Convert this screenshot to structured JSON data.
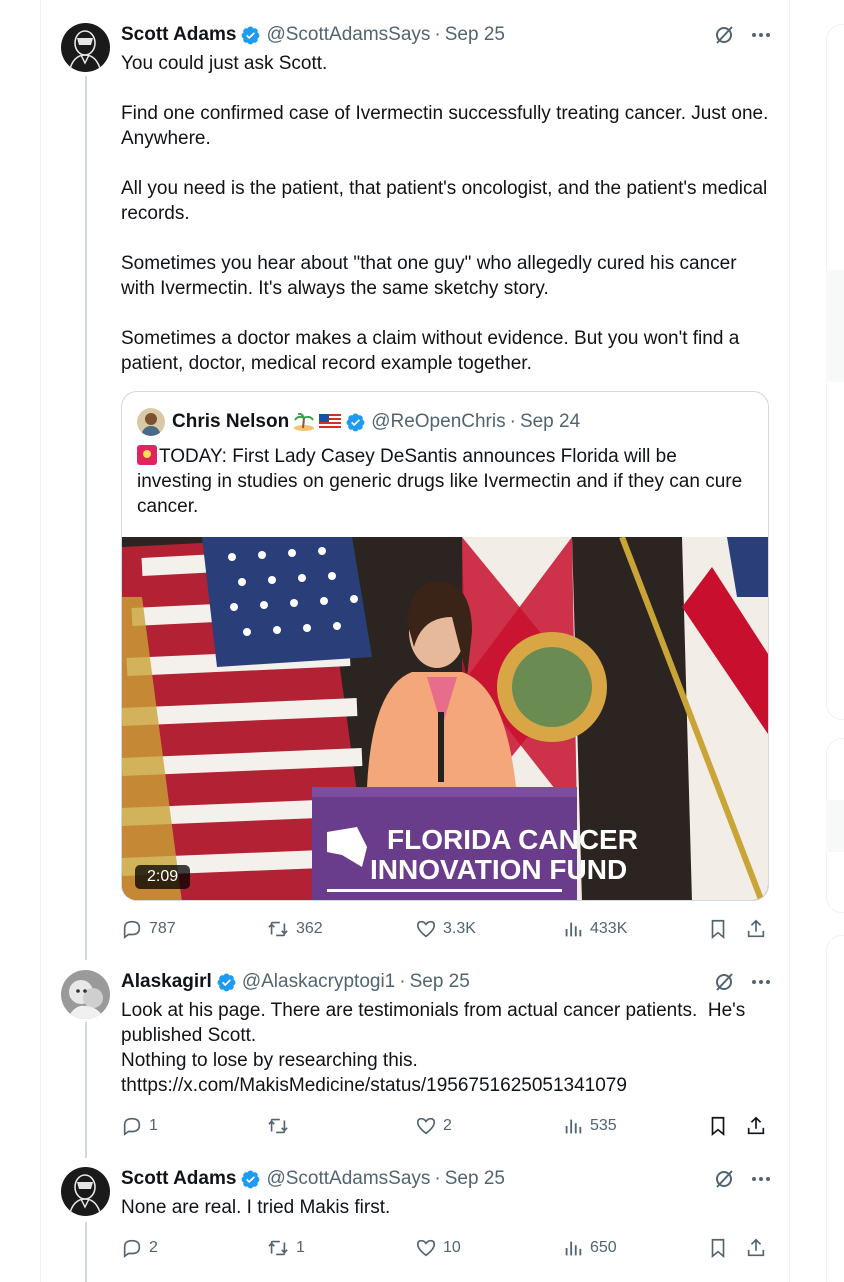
{
  "colors": {
    "text": "#0f1419",
    "secondary": "#536471",
    "verified": "#1d9bf0",
    "border": "#cfd9de"
  },
  "tweets": [
    {
      "name": "Scott Adams",
      "handle": "@ScottAdamsSays",
      "date": "Sep 25",
      "text": "You could just ask Scott.\n\nFind one confirmed case of Ivermectin successfully treating cancer. Just one. Anywhere.\n\nAll you need is the patient, that patient's oncologist, and the patient's medical records.\n\nSometimes you hear about \"that one guy\" who allegedly cured his cancer with Ivermectin. It's always the same sketchy story.\n\nSometimes a doctor makes a claim without evidence. But you won't find a patient, doctor, medical record example together.",
      "quote": {
        "name": "Chris Nelson",
        "emojis": [
          "island-emoji",
          "us-flag-emoji"
        ],
        "handle": "@ReOpenChris",
        "date": "Sep 24",
        "text": "TODAY: First Lady Casey DeSantis announces Florida will be investing in studies on generic drugs like Ivermectin and if they can cure cancer.",
        "video": {
          "duration": "2:09",
          "podium_line1": "FLORIDA CANCER",
          "podium_line2": "INNOVATION FUND"
        }
      },
      "stats": {
        "replies": "787",
        "retweets": "362",
        "likes": "3.3K",
        "views": "433K"
      }
    },
    {
      "name": "Alaskagirl",
      "handle": "@Alaskacryptogi1",
      "date": "Sep 25",
      "text": "Look at his page. There are testimonials from actual cancer patients.  He's published Scott.\nNothing to lose by researching this.\nthttps://x.com/MakisMedicine/status/1956751625051341079",
      "stats": {
        "replies": "1",
        "retweets": "",
        "likes": "2",
        "views": "535"
      }
    },
    {
      "name": "Scott Adams",
      "handle": "@ScottAdamsSays",
      "date": "Sep 25",
      "text": "None are real. I tried Makis first.",
      "stats": {
        "replies": "2",
        "retweets": "1",
        "likes": "10",
        "views": "650"
      }
    }
  ],
  "separator": "·"
}
